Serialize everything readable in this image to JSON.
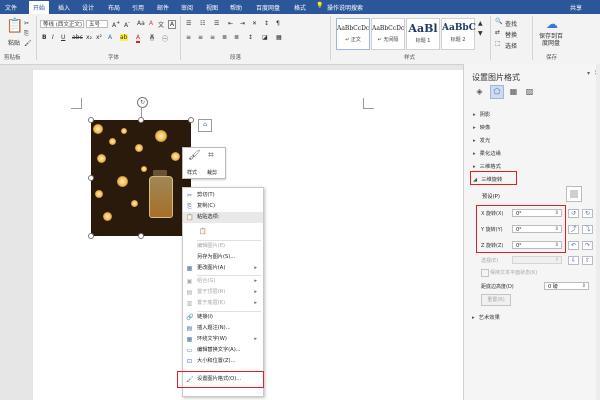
{
  "menubar": {
    "items": [
      "文件",
      "开始",
      "插入",
      "设计",
      "布局",
      "引用",
      "邮件",
      "审阅",
      "视图",
      "帮助",
      "百度网盘",
      "格式"
    ],
    "tell_me": "操作说明搜索",
    "share": "共享"
  },
  "ribbon": {
    "paste_label": "粘贴",
    "clipboard_label": "剪贴板",
    "font_name": "等线 (西文正文)",
    "font_size": "五号",
    "font_label": "字体",
    "paragraph_label": "段落",
    "styles_label": "样式",
    "styles": [
      {
        "sample": "AaBbCcDc",
        "name": "↵ 正文"
      },
      {
        "sample": "AaBbCcDc",
        "name": "↵ 无间隔"
      },
      {
        "sample": "AaBl",
        "name": "标题 1"
      },
      {
        "sample": "AaBbC",
        "name": "标题 2"
      }
    ],
    "find": "查找",
    "replace": "替换",
    "select": "选择",
    "save_to_baidu": "保存到百度网盘",
    "save_label": "保存"
  },
  "mini_toolbar": {
    "styles_label": "样式",
    "crop_label": "裁剪"
  },
  "context_menu": {
    "items": [
      {
        "label": "剪切(T)",
        "icon": "✂",
        "disabled": false
      },
      {
        "label": "复制(C)",
        "icon": "⎘",
        "disabled": false
      },
      {
        "label": "粘贴选项:",
        "icon": "📋",
        "disabled": false
      },
      {
        "label": "",
        "icon": "📋",
        "disabled": false
      },
      {
        "label": "编辑图片(E)",
        "icon": "",
        "disabled": true
      },
      {
        "label": "另存为图片(S)...",
        "icon": "",
        "disabled": false
      },
      {
        "label": "更改图片(A)",
        "icon": "▦",
        "disabled": false,
        "submenu": true
      },
      {
        "label": "组合(G)",
        "icon": "▣",
        "disabled": true,
        "submenu": true
      },
      {
        "label": "置于顶层(R)",
        "icon": "▤",
        "disabled": true,
        "submenu": true
      },
      {
        "label": "置于底层(K)",
        "icon": "▥",
        "disabled": true,
        "submenu": true
      },
      {
        "label": "链接(I)",
        "icon": "🔗",
        "disabled": false
      },
      {
        "label": "插入题注(N)...",
        "icon": "▤",
        "disabled": false
      },
      {
        "label": "环绕文字(W)",
        "icon": "▦",
        "disabled": false,
        "submenu": true
      },
      {
        "label": "编辑替换文字(A)...",
        "icon": "▭",
        "disabled": false
      },
      {
        "label": "大小和位置(Z)...",
        "icon": "⊡",
        "disabled": false
      },
      {
        "label": "设置图片格式(O)...",
        "icon": "🖌",
        "disabled": false
      }
    ]
  },
  "pane": {
    "title": "设置图片格式",
    "sections": [
      "阴影",
      "映像",
      "发光",
      "柔化边缘",
      "三维格式",
      "三维旋转"
    ],
    "preset_label": "预设(P)",
    "rotation": [
      {
        "label": "X 旋转(X)",
        "value": "0°"
      },
      {
        "label": "Y 旋转(Y)",
        "value": "0°"
      },
      {
        "label": "Z 旋转(Z)",
        "value": "0°"
      }
    ],
    "perspective_label": "透视(E)",
    "perspective_value": "",
    "keep_text_flat": "保持文本平面状态(K)",
    "distance_label": "距底边高度(D)",
    "distance_value": "0 磅",
    "reset_label": "重置(R)",
    "art_effects": "艺术效果"
  }
}
